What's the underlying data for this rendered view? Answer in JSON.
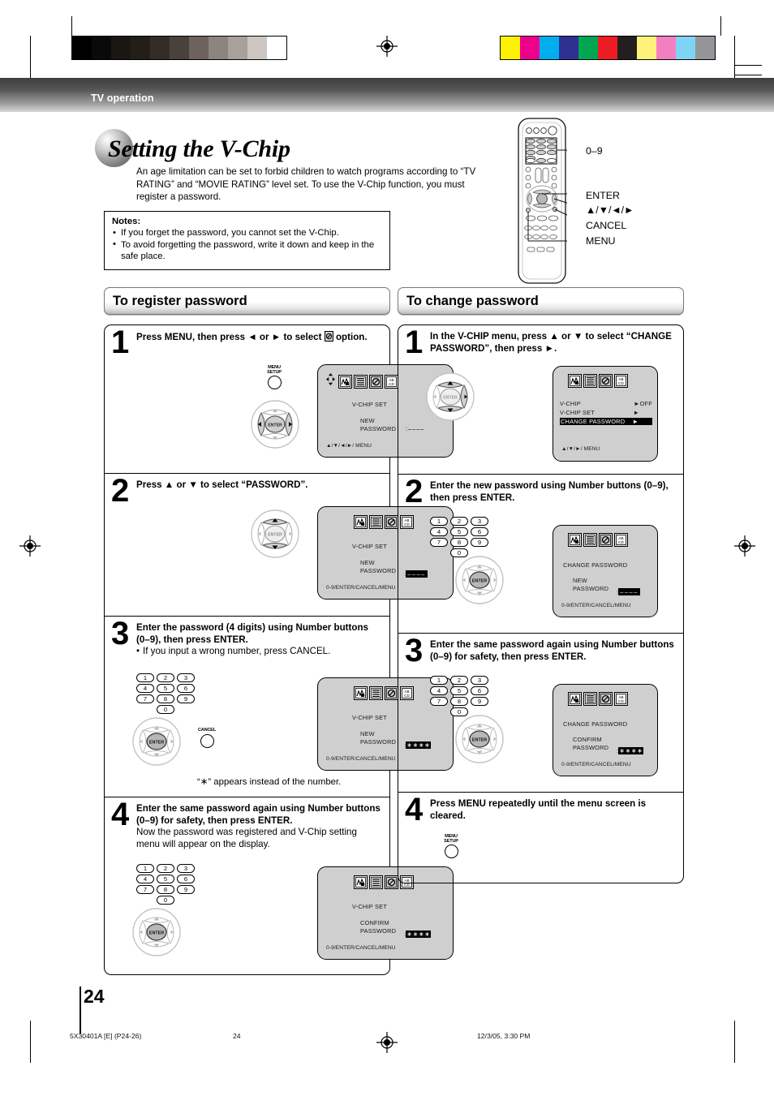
{
  "header": {
    "section_label": "TV operation"
  },
  "title": {
    "text": "Setting the V-Chip"
  },
  "intro": {
    "text": "An age limitation can be set to forbid children to watch programs according to “TV RATING” and “MOVIE RATING” level set. To use the V-Chip function, you must register a password."
  },
  "notes": {
    "heading": "Notes:",
    "items": [
      "If you forget the password, you cannot set the V-Chip.",
      "To avoid forgetting the password, write it down and keep in the safe place."
    ]
  },
  "remote_callouts": {
    "numbers": "0–9",
    "enter": "ENTER",
    "arrows": "▲/▼/◄/►",
    "cancel": "CANCEL",
    "menu": "MENU"
  },
  "sections": [
    {
      "id": "register",
      "heading": "To register password"
    },
    {
      "id": "change",
      "heading": "To change password"
    }
  ],
  "register_steps": [
    {
      "num": "1",
      "title": "Press MENU, then press ◄ or ► to select",
      "title_tail": "option.",
      "remote_button_label_top": "MENU",
      "remote_button_label_bottom": "SETUP",
      "osd": {
        "title": "V-CHIP  SET",
        "field_label_line1": "NEW",
        "field_label_line2": "PASSWORD",
        "field_value": ":––––",
        "footer": "▲/▼/◄/►/ MENU"
      }
    },
    {
      "num": "2",
      "title": "Press ▲ or ▼ to select “PASSWORD”.",
      "osd": {
        "title": "V-CHIP  SET",
        "field_label_line1": "NEW",
        "field_label_line2": "PASSWORD",
        "field_value": "––––",
        "footer": "0-9/ENTER/CANCEL/MENU"
      }
    },
    {
      "num": "3",
      "title": "Enter the password (4 digits) using Number buttons (0–9), then press ENTER.",
      "bullet": "If you input a wrong number, press CANCEL.",
      "cancel_label": "CANCEL",
      "caption": "“∗” appears instead of the number.",
      "keys": [
        "1",
        "2",
        "3",
        "4",
        "5",
        "6",
        "7",
        "8",
        "9",
        "0"
      ],
      "osd": {
        "title": "V-CHIP  SET",
        "field_label_line1": "NEW",
        "field_label_line2": "PASSWORD",
        "field_value": "∗∗∗∗",
        "footer": "0-9/ENTER/CANCEL/MENU"
      }
    },
    {
      "num": "4",
      "title": "Enter the same password again using Number buttons (0–9) for safety, then press ENTER.",
      "sub": "Now the password was registered and V-Chip setting menu will appear on the display.",
      "keys": [
        "1",
        "2",
        "3",
        "4",
        "5",
        "6",
        "7",
        "8",
        "9",
        "0"
      ],
      "osd": {
        "title": "V-CHIP  SET",
        "field_label_line1": "CONFIRM",
        "field_label_line2": "PASSWORD",
        "field_value": "∗∗∗∗",
        "footer": "0-9/ENTER/CANCEL/MENU"
      }
    }
  ],
  "change_steps": [
    {
      "num": "1",
      "title": "In the V-CHIP menu, press ▲ or ▼ to select “CHANGE PASSWORD”, then press ►.",
      "osd": {
        "rows": [
          {
            "label": "V-CHIP",
            "value": "►OFF",
            "highlight": false
          },
          {
            "label": "V-CHIP SET",
            "value": "►",
            "highlight": false
          },
          {
            "label": "CHANGE PASSWORD",
            "value": "►",
            "highlight": true
          }
        ],
        "footer": "▲/▼/►/ MENU"
      }
    },
    {
      "num": "2",
      "title": "Enter the new password using Number buttons (0–9), then press ENTER.",
      "keys": [
        "1",
        "2",
        "3",
        "4",
        "5",
        "6",
        "7",
        "8",
        "9",
        "0"
      ],
      "osd": {
        "title": "CHANGE  PASSWORD",
        "field_label_line1": "NEW",
        "field_label_line2": "PASSWORD",
        "field_value": "––––",
        "footer": "0-9/ENTER/CANCEL/MENU"
      }
    },
    {
      "num": "3",
      "title": "Enter the same password again using Number buttons (0–9) for safety, then press ENTER.",
      "keys": [
        "1",
        "2",
        "3",
        "4",
        "5",
        "6",
        "7",
        "8",
        "9",
        "0"
      ],
      "osd": {
        "title": "CHANGE  PASSWORD",
        "field_label_line1": "CONFIRM",
        "field_label_line2": "PASSWORD",
        "field_value": "∗∗∗∗",
        "footer": "0-9/ENTER/CANCEL/MENU"
      }
    },
    {
      "num": "4",
      "title": "Press MENU repeatedly until the menu screen is cleared.",
      "remote_button_label_top": "MENU",
      "remote_button_label_bottom": "SETUP"
    }
  ],
  "enter_label": "ENTER",
  "page": {
    "number": "24"
  },
  "footer": {
    "left": "5X30401A [E] (P24-26)",
    "center": "24",
    "right": "12/3/05, 3:30 PM"
  },
  "colors": {
    "grey_ramp": [
      "#000000",
      "#0a0a0a",
      "#1a1612",
      "#231e18",
      "#342c26",
      "#4a413a",
      "#6d635c",
      "#8d8480",
      "#a9a09c",
      "#cdc6c2",
      "#ffffff"
    ],
    "color_ramp": [
      "#fff200",
      "#ec008c",
      "#00aeef",
      "#2e3192",
      "#00a651",
      "#ed1c24",
      "#231f20",
      "#fff27a",
      "#f47fc0",
      "#7fd4f5",
      "#939598"
    ]
  }
}
